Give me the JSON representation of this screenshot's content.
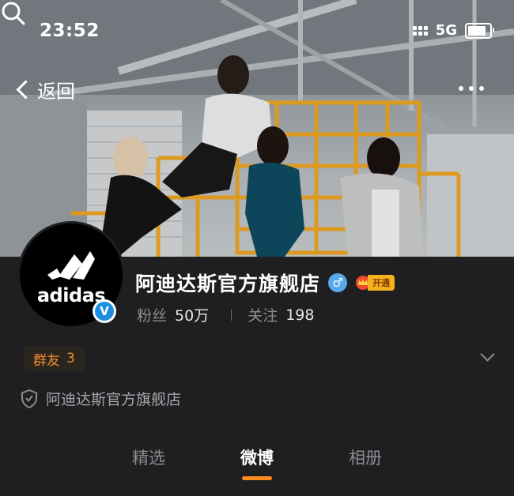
{
  "status_bar": {
    "time": "23:52",
    "network": "5G",
    "battery_level": 0.85
  },
  "nav": {
    "back_label": "返回",
    "search_icon": "search-icon",
    "more_icon": "more-dots-icon"
  },
  "profile": {
    "avatar_wordmark": "adidas",
    "verified_mark": "V",
    "name": "阿迪达斯官方旗舰店",
    "gender_symbol": "♂",
    "vip_label": "开通",
    "fans_label": "粉丝",
    "fans_value": "50万",
    "following_label": "关注",
    "following_value": "198"
  },
  "groups": {
    "label": "群友",
    "count": "3"
  },
  "verification": {
    "text": "阿迪达斯官方旗舰店"
  },
  "tabs": [
    {
      "label": "精选",
      "active": false
    },
    {
      "label": "微博",
      "active": true
    },
    {
      "label": "相册",
      "active": false
    }
  ],
  "colors": {
    "accent": "#ff8a1f",
    "background": "#1f1f21",
    "verified_blue": "#1d8fe0",
    "group_orange": "#f48a2c"
  }
}
